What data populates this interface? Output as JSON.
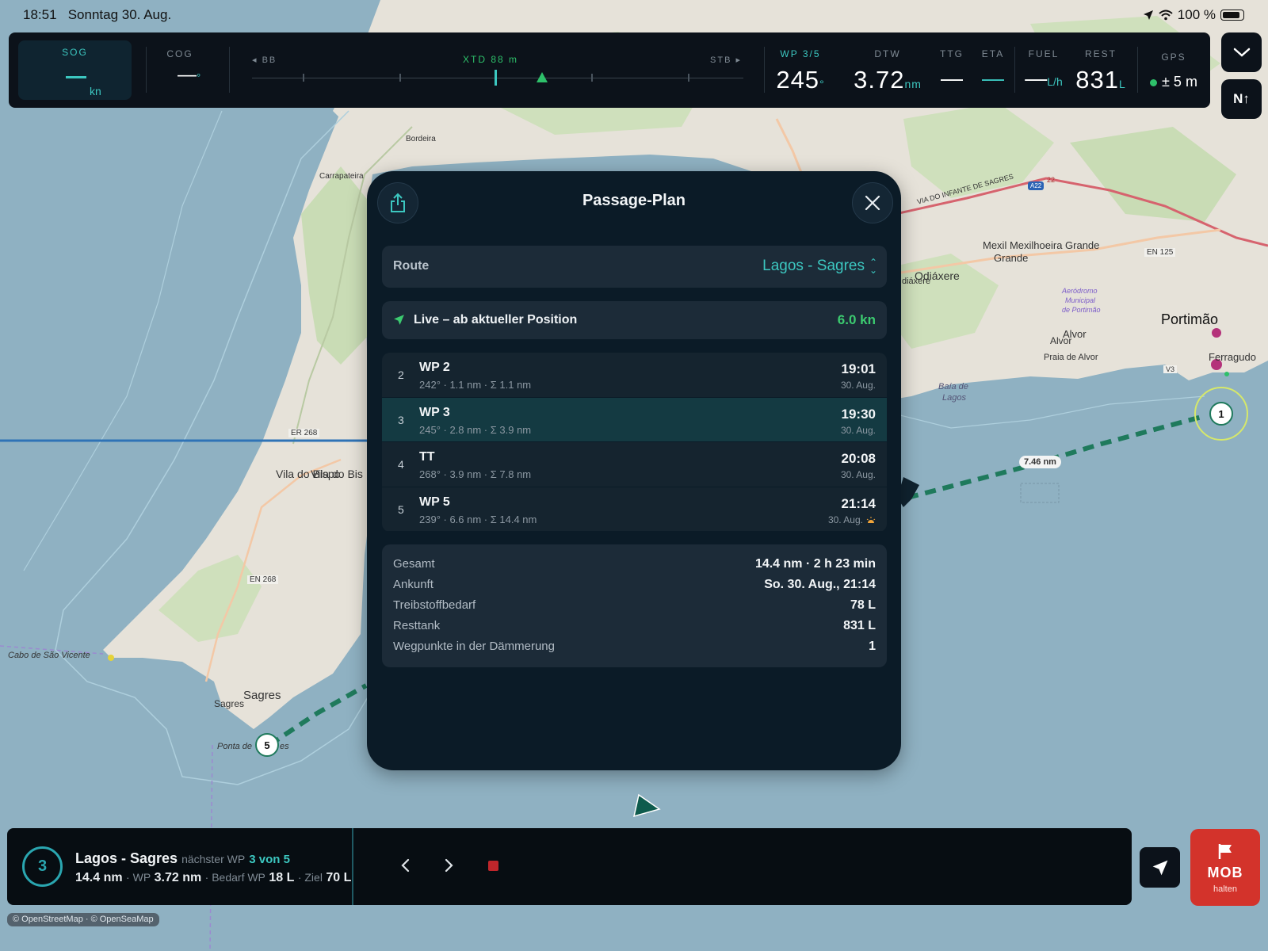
{
  "status_bar": {
    "time": "18:51",
    "date": "Sonntag 30. Aug.",
    "battery": "100 %"
  },
  "instruments": {
    "sog": {
      "label": "SOG",
      "unit": "kn"
    },
    "cog": {
      "label": "COG",
      "value": "—",
      "unit": "°"
    },
    "xtd": {
      "label": "XTD 88 m",
      "port": "◂ BB",
      "starboard": "STB ▸"
    },
    "wp": {
      "label": "WP 3/5",
      "value": "245",
      "unit": "°"
    },
    "dtw": {
      "label": "DTW",
      "value": "3.72",
      "unit": "nm"
    },
    "ttg": {
      "label": "TTG",
      "value": "—"
    },
    "eta": {
      "label": "ETA",
      "value": "—"
    },
    "fuel": {
      "label": "FUEL",
      "value": "—",
      "unit": "L/h"
    },
    "rest": {
      "label": "REST",
      "value": "831",
      "unit": "L"
    },
    "gps": {
      "label": "GPS",
      "value": "± 5 m"
    }
  },
  "map_controls": {
    "north_up": "N↑"
  },
  "map_labels": {
    "bordeira": "Bordeira",
    "carrapateira": "Carrapateira",
    "er268": "ER 268",
    "vila_do_bispo_1": "Vila do Bis",
    "vila_do_bispo_2": "Vila do Bispo",
    "en268": "EN 268",
    "cabo": "Cabo de São Vicente",
    "sagres_1": "Sagres",
    "sagres_2": "Sagres",
    "ponta": "Ponta de",
    "ponta_suffix": "es",
    "via_infante": "VIA DO INFANTE DE SAGRES",
    "a22_badge": "A22",
    "num22": "22",
    "mexil_1": "Mexil Mexilhoeira Grande",
    "mexil_2": "Grande",
    "en125": "EN 125",
    "odiaxere": "Odiáxere",
    "odiaxere_frag": "diáxere",
    "aerodromo_1": "Aeródromo",
    "aerodromo_2": "Municipal",
    "aerodromo_3": "de Portimão",
    "portimao": "Portimão",
    "alvor": "Alvor",
    "alvor_2": "Alvor",
    "praia_alvor": "Praia de Alvor",
    "ferragudo": "Ferragudo",
    "v3": "V3",
    "baia_1": "Baía de",
    "baia_2": "Lagos",
    "distance_badge": "7.46 nm",
    "wp_marker_1": "1",
    "wp_marker_5": "5"
  },
  "passage_plan": {
    "title": "Passage-Plan",
    "route_label": "Route",
    "route_value": "Lagos - Sagres",
    "live_label": "Live – ab aktueller Position",
    "live_speed": "6.0 kn",
    "waypoints": [
      {
        "num": "2",
        "name": "WP 2",
        "detail": "242° · 1.1 nm · Σ 1.1 nm",
        "time": "19:01",
        "date": "30. Aug.",
        "active": false,
        "twilight": false
      },
      {
        "num": "3",
        "name": "WP 3",
        "detail": "245° · 2.8 nm · Σ 3.9 nm",
        "time": "19:30",
        "date": "30. Aug.",
        "active": true,
        "twilight": false
      },
      {
        "num": "4",
        "name": "TT",
        "detail": "268° · 3.9 nm · Σ 7.8 nm",
        "time": "20:08",
        "date": "30. Aug.",
        "active": false,
        "twilight": false
      },
      {
        "num": "5",
        "name": "WP 5",
        "detail": "239° · 6.6 nm · Σ 14.4 nm",
        "time": "21:14",
        "date": "30. Aug.",
        "active": false,
        "twilight": true
      }
    ],
    "summary": {
      "total_label": "Gesamt",
      "total_value": "14.4 nm · 2 h 23 min",
      "arrival_label": "Ankunft",
      "arrival_value": "So. 30. Aug., 21:14",
      "fuel_label": "Treibstoffbedarf",
      "fuel_value": "78 L",
      "tank_label": "Resttank",
      "tank_value": "831 L",
      "twilight_label": "Wegpunkte in der Dämmerung",
      "twilight_value": "1"
    }
  },
  "route_bar": {
    "active_wp": "3",
    "route_name": "Lagos - Sagres",
    "next_wp_label": "nächster WP",
    "next_wp_value": "3 von 5",
    "distance": "14.4 nm",
    "wp_label": "· WP",
    "wp_distance": "3.72 nm",
    "demand_label": "· Bedarf WP",
    "demand_value": "18 L",
    "target_label": "· Ziel",
    "target_value": "70 L"
  },
  "mob": {
    "label": "MOB",
    "sub": "halten"
  },
  "attribution": "© OpenStreetMap · © OpenSeaMap",
  "colors": {
    "accent": "#3cc7c0",
    "green": "#2ec06a",
    "mob_red": "#d3332b",
    "panel_bg": "#0b1b27"
  }
}
